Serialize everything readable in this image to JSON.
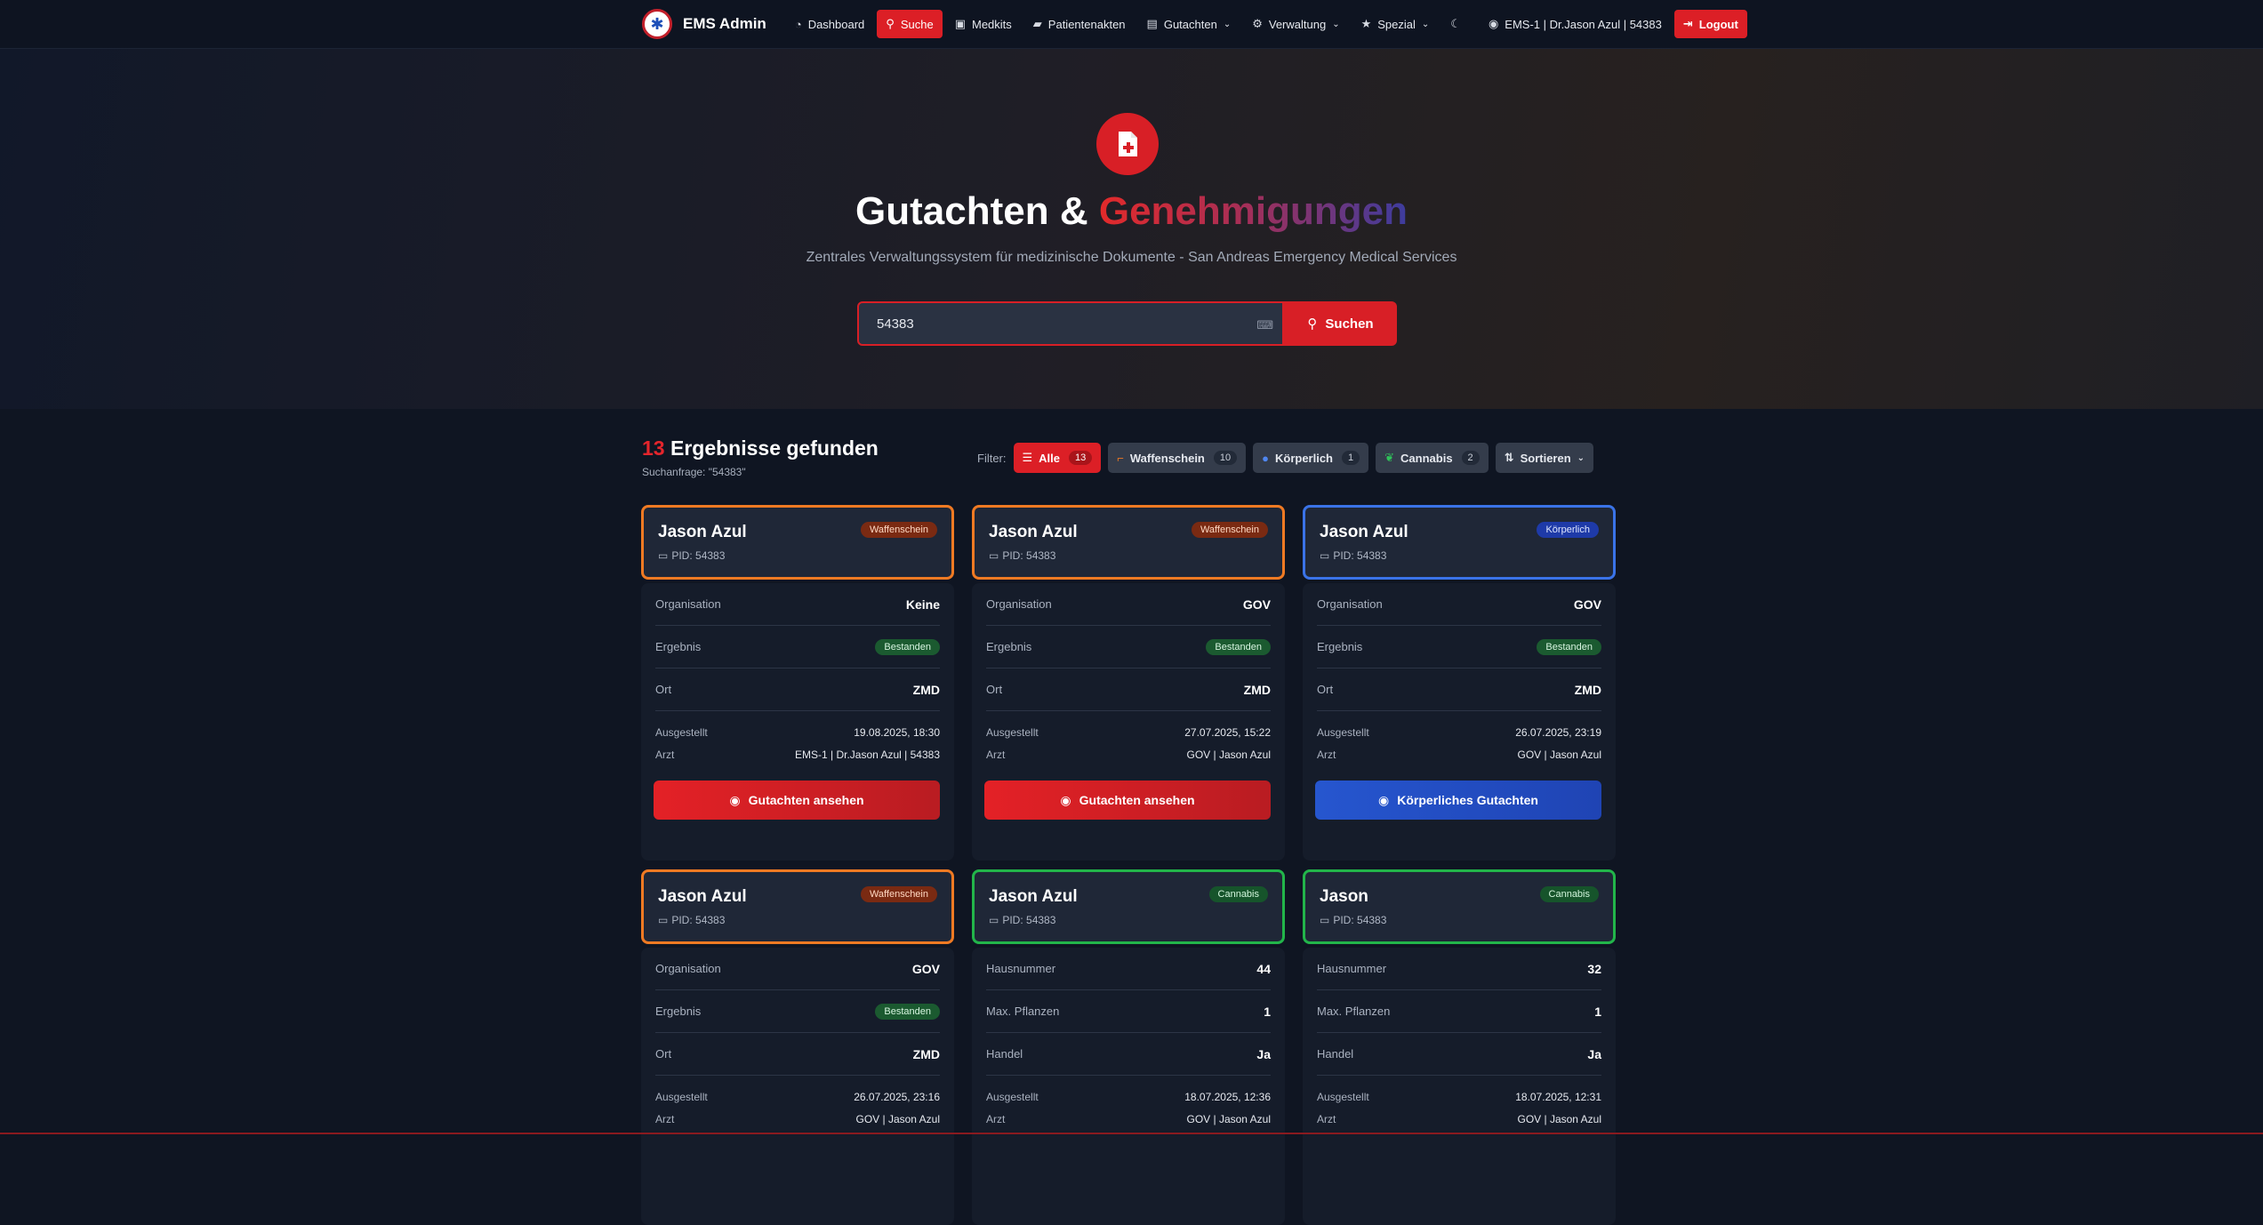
{
  "nav": {
    "brand": "EMS Admin",
    "items": [
      {
        "label": "Dashboard",
        "icon": "dashboard-icon"
      },
      {
        "label": "Suche",
        "icon": "search-icon"
      },
      {
        "label": "Medkits",
        "icon": "medkit-icon"
      },
      {
        "label": "Patientenakten",
        "icon": "folder-icon"
      },
      {
        "label": "Gutachten",
        "icon": "document-icon"
      },
      {
        "label": "Verwaltung",
        "icon": "gear-icon"
      },
      {
        "label": "Spezial",
        "icon": "star-icon"
      }
    ],
    "user": "EMS-1 | Dr.Jason Azul | 54383",
    "logout": "Logout"
  },
  "hero": {
    "title_main": "Gutachten &",
    "title_accent": "Genehmigungen",
    "subtitle": "Zentrales Verwaltungssystem für medizinische Dokumente - San Andreas Emergency Medical Services",
    "search_value": "54383",
    "search_button": "Suchen"
  },
  "results": {
    "count": "13",
    "title": "Ergebnisse gefunden",
    "query": "Suchanfrage: \"54383\""
  },
  "filters": {
    "label": "Filter:",
    "all": {
      "label": "Alle",
      "count": "13"
    },
    "weapon": {
      "label": "Waffenschein",
      "count": "10"
    },
    "physical": {
      "label": "Körperlich",
      "count": "1"
    },
    "cannabis": {
      "label": "Cannabis",
      "count": "2"
    },
    "sort": "Sortieren"
  },
  "cards": [
    {
      "name": "Jason Azul",
      "pid": "PID: 54383",
      "type": "Waffenschein",
      "r1l": "Organisation",
      "r1v": "Keine",
      "r2l": "Ergebnis",
      "r2v": "Bestanden",
      "r3l": "Ort",
      "r3v": "ZMD",
      "r4l": "Ausgestellt",
      "r4v": "19.08.2025, 18:30",
      "r5l": "Arzt",
      "r5v": "EMS-1 | Dr.Jason Azul | 54383",
      "button": "Gutachten ansehen"
    },
    {
      "name": "Jason Azul",
      "pid": "PID: 54383",
      "type": "Waffenschein",
      "r1l": "Organisation",
      "r1v": "GOV",
      "r2l": "Ergebnis",
      "r2v": "Bestanden",
      "r3l": "Ort",
      "r3v": "ZMD",
      "r4l": "Ausgestellt",
      "r4v": "27.07.2025, 15:22",
      "r5l": "Arzt",
      "r5v": "GOV | Jason Azul",
      "button": "Gutachten ansehen"
    },
    {
      "name": "Jason Azul",
      "pid": "PID: 54383",
      "type": "Körperlich",
      "r1l": "Organisation",
      "r1v": "GOV",
      "r2l": "Ergebnis",
      "r2v": "Bestanden",
      "r3l": "Ort",
      "r3v": "ZMD",
      "r4l": "Ausgestellt",
      "r4v": "26.07.2025, 23:19",
      "r5l": "Arzt",
      "r5v": "GOV | Jason Azul",
      "button": "Körperliches Gutachten"
    },
    {
      "name": "Jason Azul",
      "pid": "PID: 54383",
      "type": "Waffenschein",
      "r1l": "Organisation",
      "r1v": "GOV",
      "r2l": "Ergebnis",
      "r2v": "Bestanden",
      "r3l": "Ort",
      "r3v": "ZMD",
      "r4l": "Ausgestellt",
      "r4v": "26.07.2025, 23:16",
      "r5l": "Arzt",
      "r5v": "GOV | Jason Azul"
    },
    {
      "name": "Jason Azul",
      "pid": "PID: 54383",
      "type": "Cannabis",
      "r1l": "Hausnummer",
      "r1v": "44",
      "r2l": "Max. Pflanzen",
      "r2v": "1",
      "r3l": "Handel",
      "r3v": "Ja",
      "r4l": "Ausgestellt",
      "r4v": "18.07.2025, 12:36",
      "r5l": "Arzt",
      "r5v": "GOV | Jason Azul"
    },
    {
      "name": "Jason",
      "pid": "PID: 54383",
      "type": "Cannabis",
      "r1l": "Hausnummer",
      "r1v": "32",
      "r2l": "Max. Pflanzen",
      "r2v": "1",
      "r3l": "Handel",
      "r3v": "Ja",
      "r4l": "Ausgestellt",
      "r4v": "18.07.2025, 12:31",
      "r5l": "Arzt",
      "r5v": "GOV | Jason Azul"
    }
  ],
  "colors": {
    "accent": "#dc1f26",
    "weapon_border": "#f07a23",
    "physical_border": "#3a73e8",
    "cannabis_border": "#22b54a",
    "background": "#0f1522"
  }
}
